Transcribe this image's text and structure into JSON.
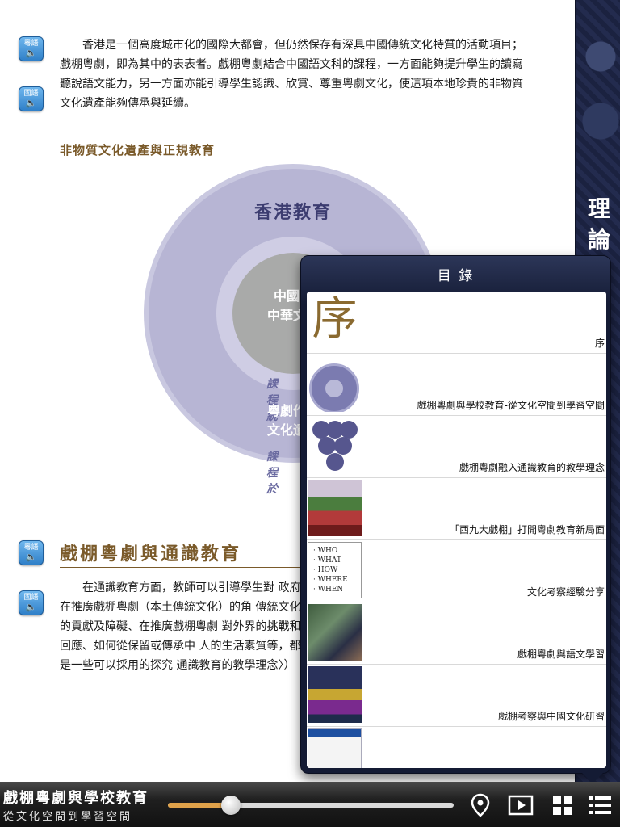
{
  "page": {
    "audio_cantonese": "粵語",
    "audio_mandarin": "國語",
    "intro_paragraph": "香港是一個高度城市化的國際大都會，但仍然保存有深具中國傳統文化特質的活動項目；戲棚粵劇，即為其中的表表者。戲棚粵劇結合中國語文科的課程，一方面能夠提升學生的讀寫聽說語文能力，另一方面亦能引導學生認識、欣賞、尊重粵劇文化，使這項本地珍貴的非物質文化遺產能夠傳承與延續。",
    "sub_heading": "非物質文化遺產與正規教育",
    "diagram": {
      "title": "香港教育",
      "inner_line1": "中國語",
      "inner_line2": "中華文化",
      "arc_top": "課程統",
      "lower_line1": "粵劇作為",
      "lower_line2": "文化遺產",
      "arc_bottom": "課程於"
    },
    "section_heading": "戲棚粵劇與通識教育",
    "section_paragraph": "在通識教育方面，教師可以引導學生對 政府在推廣戲棚粵劇（本土傳統文化）的角 傳統文化）的貢獻及障礙、在推廣戲棚粵劇 對外界的挑戰和回應、如何從保留或傳承中 人的生活素質等，都是一些可以採用的探究 通識教育的教學理念〉）"
  },
  "strip": {
    "title_chars": [
      "理",
      "論"
    ]
  },
  "toc": {
    "title": "目 錄",
    "items": [
      {
        "label": "序",
        "thumb_text": "序"
      },
      {
        "label": "戲棚粵劇與學校教育-從文化空間到學習空間"
      },
      {
        "label": "戲棚粵劇融入通識教育的教學理念"
      },
      {
        "label": "「西九大戲棚」打開粵劇教育新局面"
      },
      {
        "label": "文化考察經驗分享",
        "thumb_lines": [
          "· WHO",
          "· WHAT",
          "· HOW",
          "· WHERE",
          "· WHEN"
        ]
      },
      {
        "label": "戲棚粵劇與語文學習"
      },
      {
        "label": "戲棚考察與中國文化研習"
      },
      {
        "label": ""
      }
    ]
  },
  "bottombar": {
    "title": "戲棚粵劇與學校教育",
    "subtitle": "從文化空間到學習空間",
    "progress": 0.22,
    "icons": [
      "location-pin-icon",
      "play-video-icon",
      "grid-view-icon",
      "list-menu-icon"
    ]
  },
  "colors": {
    "accent_gold": "#7a5a2a",
    "navy": "#141b34",
    "slider_fill": "#e0a24a"
  }
}
